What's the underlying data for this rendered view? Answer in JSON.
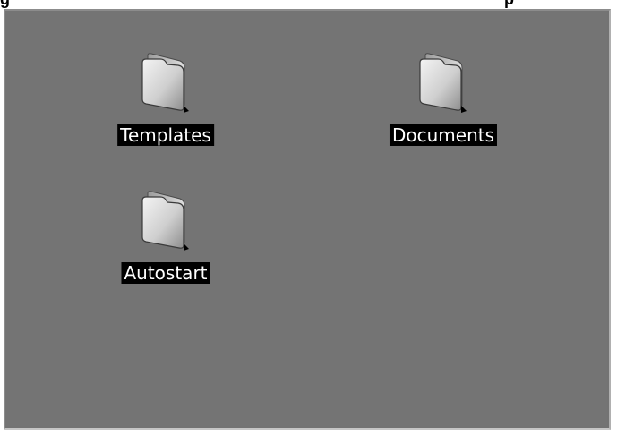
{
  "window": {
    "title_left": "g",
    "title_right": "p"
  },
  "desktop": {
    "icons": [
      {
        "label": "Templates",
        "icon": "folder-icon"
      },
      {
        "label": "Documents",
        "icon": "folder-icon"
      },
      {
        "label": "Autostart",
        "icon": "folder-icon"
      }
    ]
  },
  "colors": {
    "desktop_background": "#747474",
    "label_background": "#000000",
    "label_text": "#ffffff"
  }
}
